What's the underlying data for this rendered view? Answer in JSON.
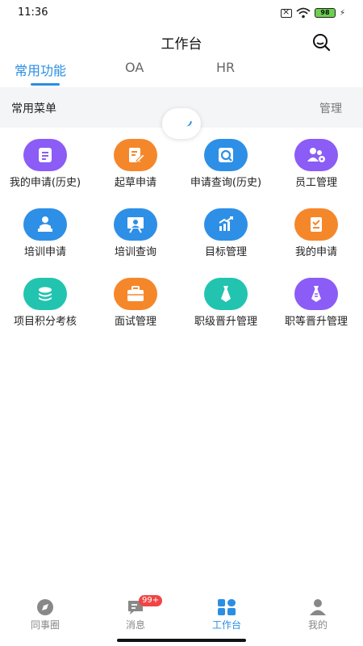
{
  "status_bar": {
    "time": "11:36",
    "battery": "98"
  },
  "header": {
    "title": "工作台"
  },
  "tabs": [
    {
      "label": "常用功能",
      "active": true
    },
    {
      "label": "OA",
      "active": false
    },
    {
      "label": "HR",
      "active": false
    }
  ],
  "section": {
    "title": "常用菜单",
    "manage_label": "管理"
  },
  "menu": [
    {
      "label": "我的申请(历史)",
      "icon": "document-list-icon",
      "color": "#8b5cf6"
    },
    {
      "label": "起草申请",
      "icon": "edit-document-icon",
      "color": "#f5872b"
    },
    {
      "label": "申请查询(历史)",
      "icon": "search-document-icon",
      "color": "#2e8fe6"
    },
    {
      "label": "员工管理",
      "icon": "users-settings-icon",
      "color": "#8b5cf6"
    },
    {
      "label": "培训申请",
      "icon": "trainer-icon",
      "color": "#2e8fe6"
    },
    {
      "label": "培训查询",
      "icon": "presentation-icon",
      "color": "#2e8fe6"
    },
    {
      "label": "目标管理",
      "icon": "growth-chart-icon",
      "color": "#2e8fe6"
    },
    {
      "label": "我的申请",
      "icon": "checklist-icon",
      "color": "#f5872b"
    },
    {
      "label": "项目积分考核",
      "icon": "coin-stack-icon",
      "color": "#22c4b0"
    },
    {
      "label": "面试管理",
      "icon": "briefcase-icon",
      "color": "#f5872b"
    },
    {
      "label": "职级晋升管理",
      "icon": "tie-icon",
      "color": "#22c4b0"
    },
    {
      "label": "职等晋升管理",
      "icon": "tie-badge-icon",
      "color": "#8b5cf6"
    }
  ],
  "bottom_nav": [
    {
      "label": "同事圈",
      "icon": "compass-icon",
      "active": false
    },
    {
      "label": "消息",
      "icon": "message-icon",
      "active": false,
      "badge": "99+"
    },
    {
      "label": "工作台",
      "icon": "grid-icon",
      "active": true
    },
    {
      "label": "我的",
      "icon": "person-icon",
      "active": false
    }
  ],
  "colors": {
    "accent": "#2a8ee3",
    "badge": "#f04545"
  }
}
